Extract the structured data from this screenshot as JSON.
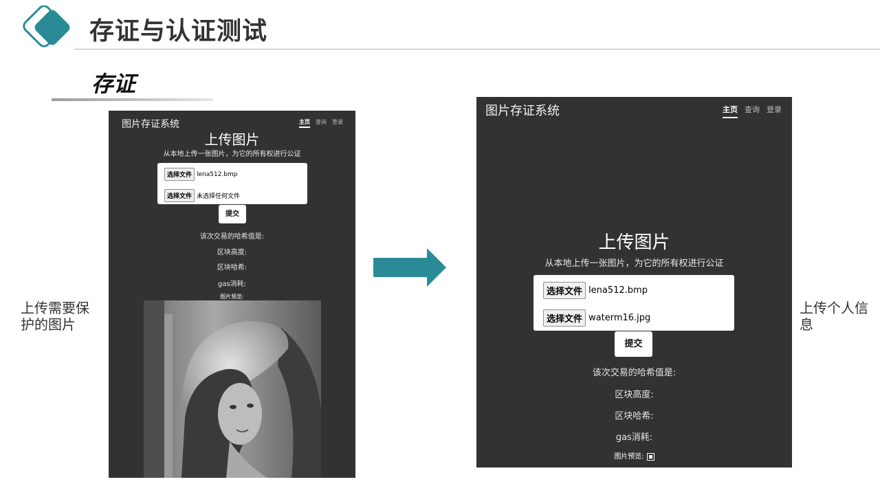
{
  "slide": {
    "title": "存证与认证测试",
    "subtitle": "存证",
    "left_label": "上传需要保护的图片",
    "right_label": "上传个人信息",
    "accent_color": "#2a8b96"
  },
  "left_screen": {
    "brand": "图片存证系统",
    "nav": [
      "主页",
      "查询",
      "登录"
    ],
    "heading": "上传图片",
    "description": "从本地上传一张图片，为它的所有权进行公证",
    "file1": {
      "button": "选择文件",
      "name": "lena512.bmp"
    },
    "file2": {
      "button": "选择文件",
      "name": "未选择任何文件"
    },
    "submit": "提交",
    "hash_label": "该次交易的哈希值是:",
    "block_height_label": "区块高度:",
    "block_hash_label": "区块哈希:",
    "gas_label": "gas消耗:",
    "preview_label": "图片预览:"
  },
  "right_screen": {
    "brand": "图片存证系统",
    "nav": [
      "主页",
      "查询",
      "登录"
    ],
    "heading": "上传图片",
    "description": "从本地上传一张图片，为它的所有权进行公证",
    "file1": {
      "button": "选择文件",
      "name": "lena512.bmp"
    },
    "file2": {
      "button": "选择文件",
      "name": "waterm16.jpg"
    },
    "submit": "提交",
    "hash_label": "该次交易的哈希值是:",
    "block_height_label": "区块高度:",
    "block_hash_label": "区块哈希:",
    "gas_label": "gas消耗:",
    "preview_label": "图片预览:"
  }
}
